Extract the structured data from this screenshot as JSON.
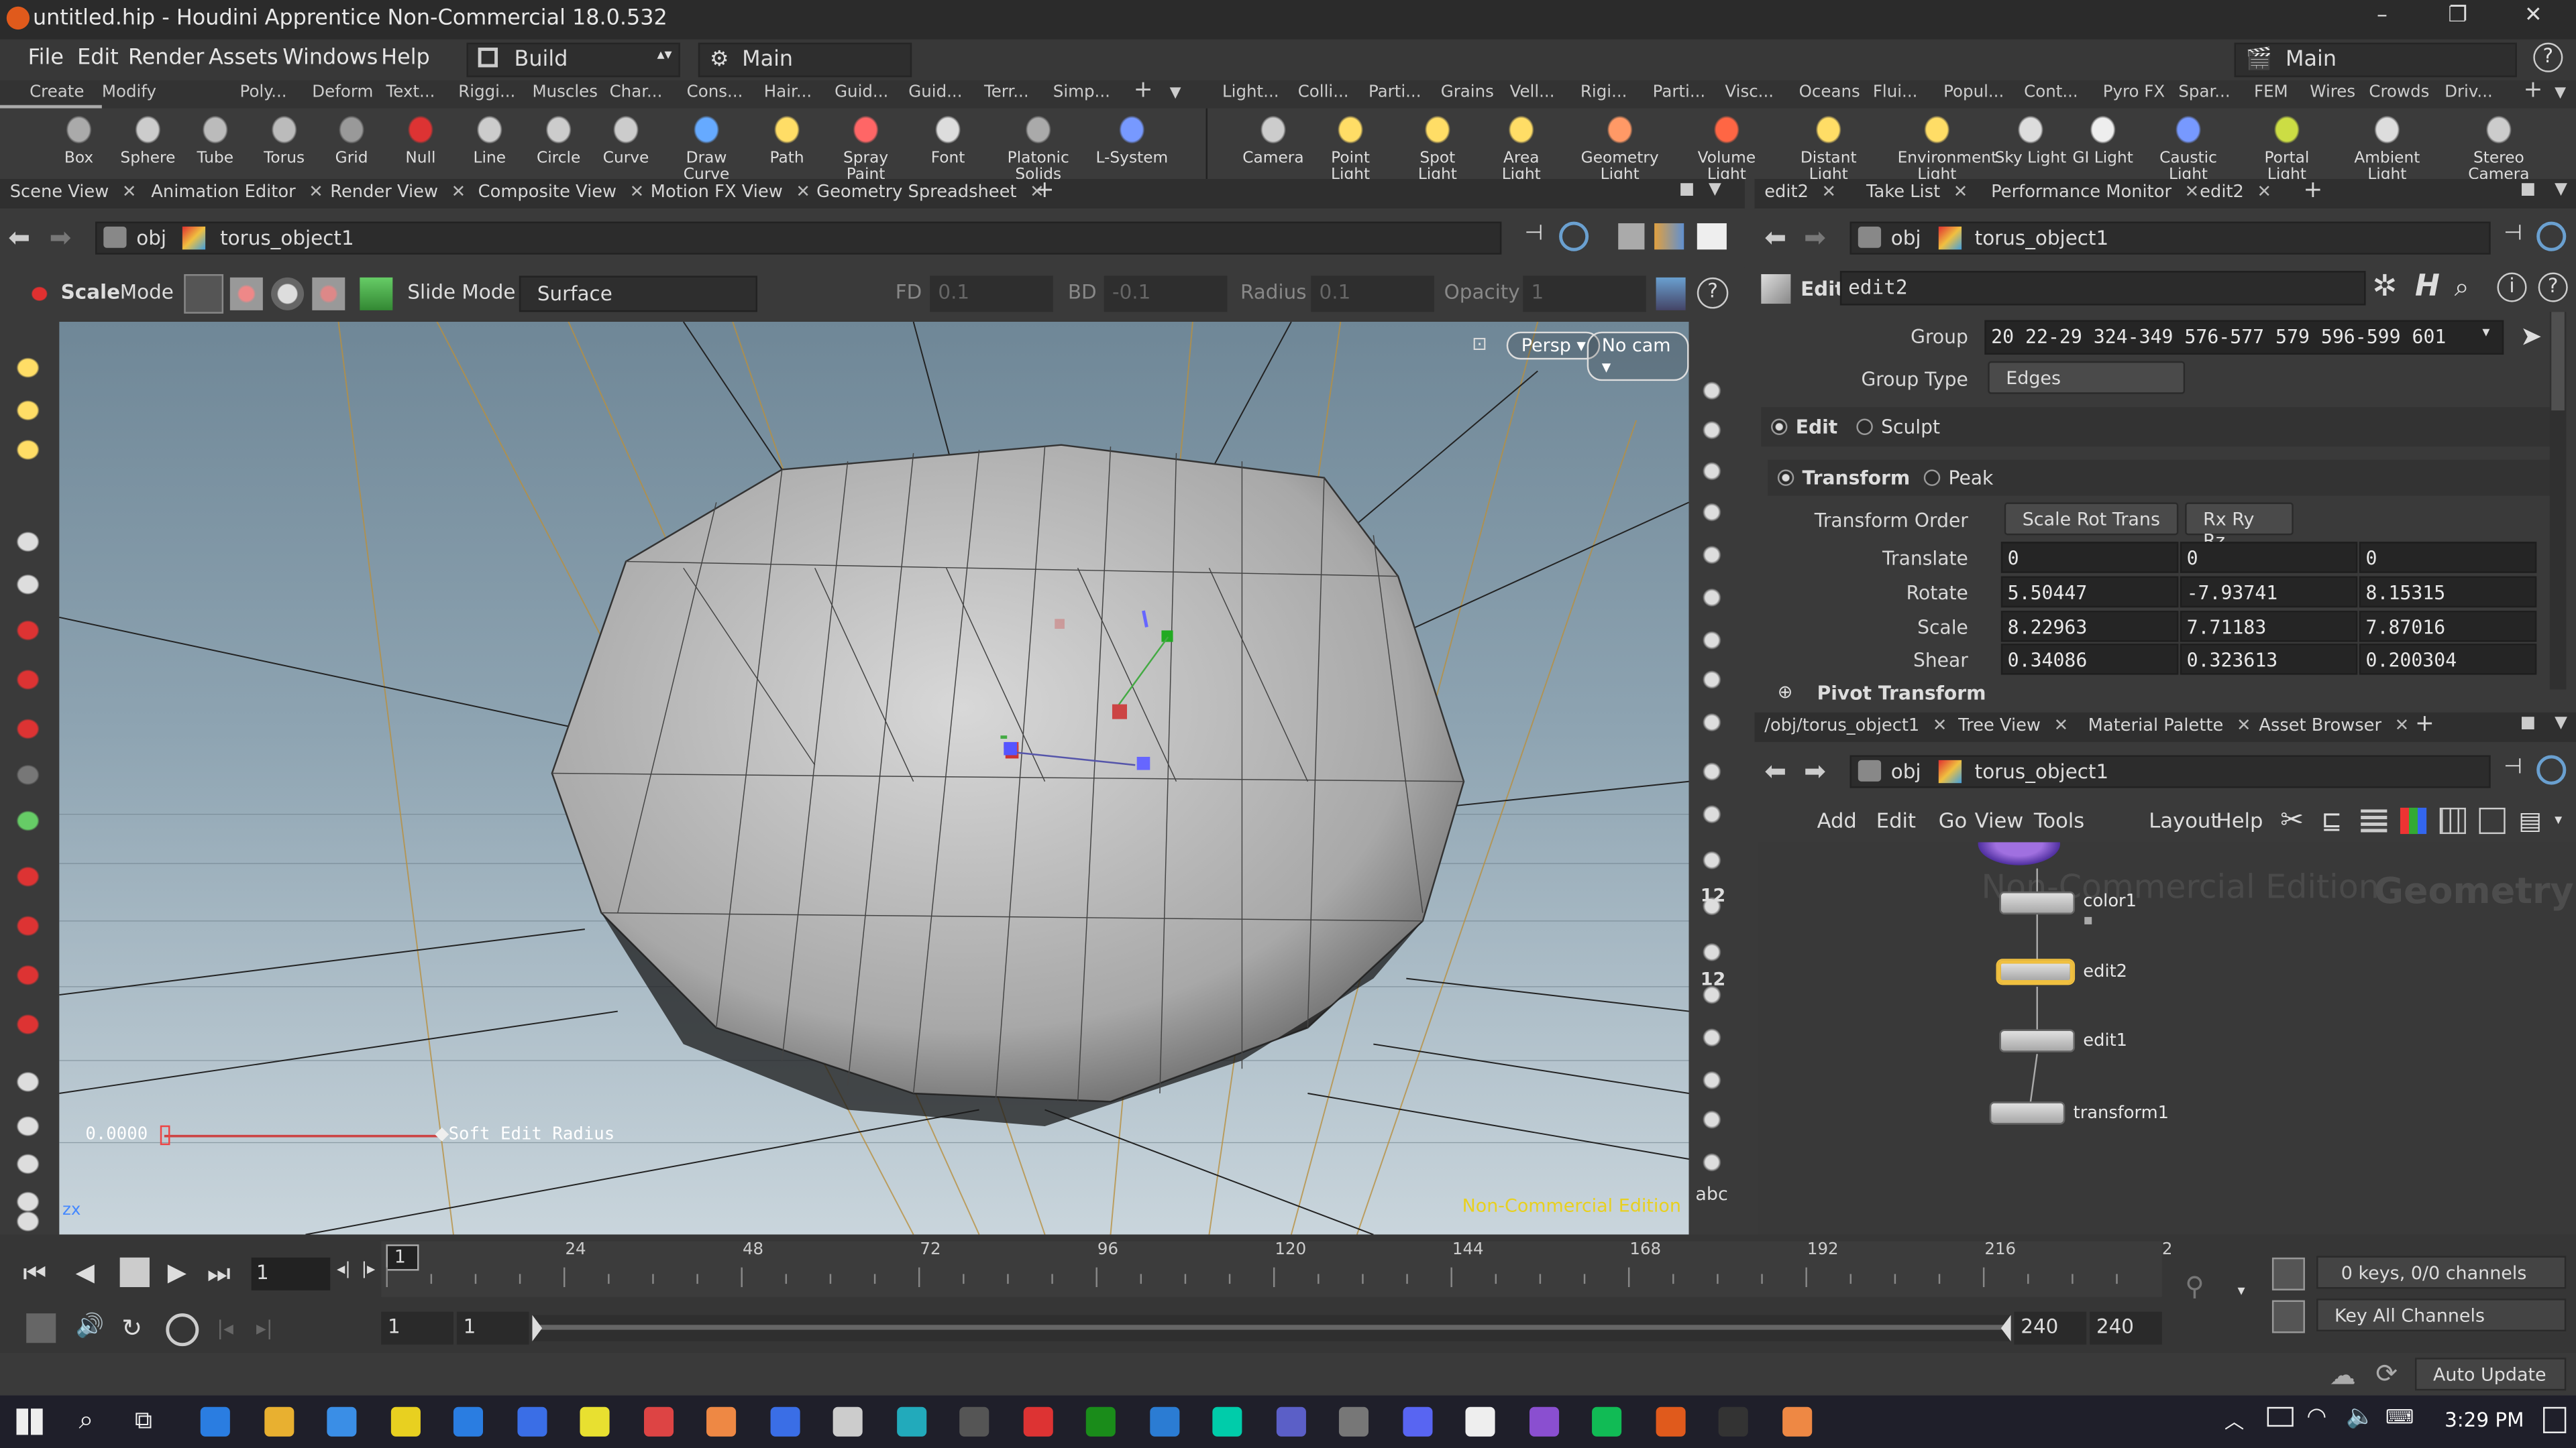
{
  "window": {
    "title": "untitled.hip - Houdini Apprentice Non-Commercial 18.0.532",
    "controls": [
      "–",
      "❐",
      "✕"
    ]
  },
  "menubar": {
    "items": [
      "File",
      "Edit",
      "Render",
      "Assets",
      "Windows",
      "Help"
    ],
    "desktop": "Build",
    "main_set": "Main",
    "right_set": "Main"
  },
  "shelf_tabs_left": [
    "Create",
    "Modify",
    "Poly...",
    "Deform",
    "Text...",
    "Riggi...",
    "Muscles",
    "Char...",
    "Cons...",
    "Hair...",
    "Guid...",
    "Guid...",
    "Terr...",
    "Simp..."
  ],
  "shelf_tabs_right": [
    "Light...",
    "Colli...",
    "Parti...",
    "Grains",
    "Vell...",
    "Rigi...",
    "Parti...",
    "Visc...",
    "Oceans",
    "Flui...",
    "Popul...",
    "Cont...",
    "Pyro FX",
    "Spar...",
    "FEM",
    "Wires",
    "Crowds",
    "Driv..."
  ],
  "shelf_tools_left": [
    "Box",
    "Sphere",
    "Tube",
    "Torus",
    "Grid",
    "Null",
    "Line",
    "Circle",
    "Curve",
    "Draw Curve",
    "Path",
    "Spray Paint",
    "Font",
    "Platonic Solids",
    "L-System"
  ],
  "shelf_tools_right": [
    "Camera",
    "Point Light",
    "Spot Light",
    "Area Light",
    "Geometry Light",
    "Volume Light",
    "Distant Light",
    "Environment Light",
    "Sky Light",
    "GI Light",
    "Caustic Light",
    "Portal Light",
    "Ambient Light",
    "Stereo Camera"
  ],
  "left_tabs": [
    "Scene View",
    "Animation Editor",
    "Render View",
    "Composite View",
    "Motion FX View",
    "Geometry Spreadsheet"
  ],
  "right_top_tabs": [
    "edit2",
    "Take List",
    "Performance Monitor",
    "edit2"
  ],
  "right_bottom_tabs": [
    "/obj/torus_object1",
    "Tree View",
    "Material Palette",
    "Asset Browser"
  ],
  "path": {
    "context": "obj",
    "object": "torus_object1"
  },
  "tool_options": {
    "tool": "Scale",
    "mode_label": "Mode",
    "slide_mode": "Slide Mode",
    "surface": "Surface",
    "fd_label": "FD",
    "fd_value": "0.1",
    "bd_label": "BD",
    "bd_value": "-0.1",
    "radius_label": "Radius",
    "radius_value": "0.1",
    "opacity_label": "Opacity",
    "opacity_value": "1"
  },
  "viewport": {
    "camera_persp": "Persp",
    "camera_nocam": "No cam",
    "soft_value": "0.0000",
    "soft_label": "Soft Edit Radius",
    "watermark": "Non-Commercial Edition",
    "axis": "zx"
  },
  "right_toolbar_numbers": [
    "12",
    "12"
  ],
  "right_toolbar_abc": "abc",
  "params": {
    "node_type": "Edit",
    "node_name": "edit2",
    "group_label": "Group",
    "group_value": "20 22-29 324-349 576-577 579 596-599 601",
    "group_type_label": "Group Type",
    "group_type_value": "Edges",
    "mode_edit": "Edit",
    "mode_sculpt": "Sculpt",
    "sub_transform": "Transform",
    "sub_peak": "Peak",
    "transform_order_label": "Transform Order",
    "transform_order_value": "Scale Rot Trans",
    "rot_order_value": "Rx Ry Rz",
    "translate_label": "Translate",
    "translate": [
      "0",
      "0",
      "0"
    ],
    "rotate_label": "Rotate",
    "rotate": [
      "5.50447",
      "-7.93741",
      "8.15315"
    ],
    "scale_label": "Scale",
    "scale": [
      "8.22963",
      "7.71183",
      "7.87016"
    ],
    "shear_label": "Shear",
    "shear": [
      "0.34086",
      "0.323613",
      "0.200304"
    ],
    "pivot_label": "Pivot Transform"
  },
  "network_menu": [
    "Add",
    "Edit",
    "Go",
    "View",
    "Tools",
    "Layout",
    "Help"
  ],
  "network": {
    "watermark_1": "Non-Commercial Edition",
    "watermark_2": "Geometry",
    "nodes": [
      "color1",
      "edit2",
      "edit1",
      "transform1"
    ]
  },
  "timeline": {
    "frame": "1",
    "ticks": [
      "1",
      "24",
      "48",
      "72",
      "96",
      "120",
      "144",
      "168",
      "192",
      "216",
      "2"
    ],
    "range_start_a": "1",
    "range_start_b": "1",
    "range_end_a": "240",
    "range_end_b": "240",
    "keys_label": "0 keys, 0/0 channels",
    "key_all": "Key All Channels",
    "auto_update": "Auto Update"
  },
  "taskbar": {
    "time": "3:29 PM"
  },
  "colors": {
    "accent_selected": "#f0c040",
    "houdini_orange": "#e05a1c",
    "watermark_yellow": "#e8d020"
  }
}
